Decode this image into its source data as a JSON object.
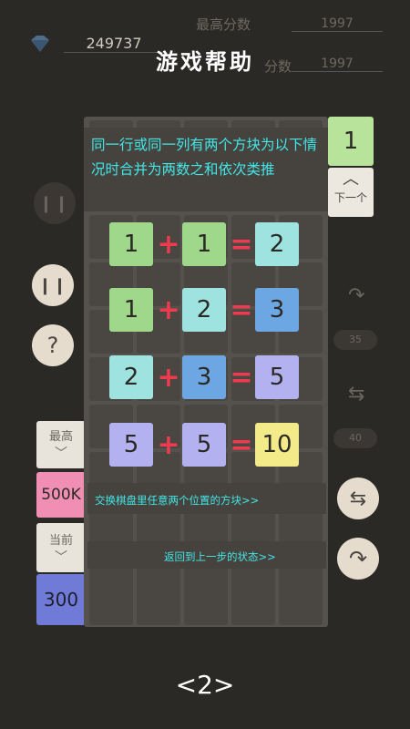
{
  "header": {
    "coins": "249737",
    "best_score_label": "最高分数",
    "best_score": "1997",
    "current_score_label": "分数",
    "current_score": "1997"
  },
  "help": {
    "title": "游戏帮助",
    "instruction": "同一行或同一列有两个方块为以下情况时合并为两数之和依次类推",
    "swap_hint": "交换棋盘里任意两个位置的方块>>",
    "undo_hint": "返回到上一步的状态>>",
    "page": "<2>"
  },
  "side": {
    "next_tile_value": "1",
    "next_label": "下一个",
    "best_label": "最高",
    "best_value": "500K",
    "current_label": "当前",
    "current_value": "300",
    "undo_count": "35",
    "swap_count": "40"
  },
  "equations": [
    {
      "a": "1",
      "b": "1",
      "sum": "2"
    },
    {
      "a": "1",
      "b": "2",
      "sum": "3"
    },
    {
      "a": "2",
      "b": "3",
      "sum": "5"
    },
    {
      "a": "5",
      "b": "5",
      "sum": "10"
    }
  ],
  "symbols": {
    "plus": "+",
    "equals": "="
  },
  "colors": {
    "tile_1": "#9fd88a",
    "tile_2": "#9ee3df",
    "tile_3": "#6da7e3",
    "tile_5": "#b3b1ef",
    "tile_10": "#f3ea8a",
    "operator": "#f03a4f",
    "hint_text": "#43e6e6"
  },
  "icons": [
    "gem-icon",
    "pause-icon",
    "help-icon",
    "undo-icon",
    "swap-icon",
    "chevron-down-icon",
    "chevron-up-icon"
  ]
}
